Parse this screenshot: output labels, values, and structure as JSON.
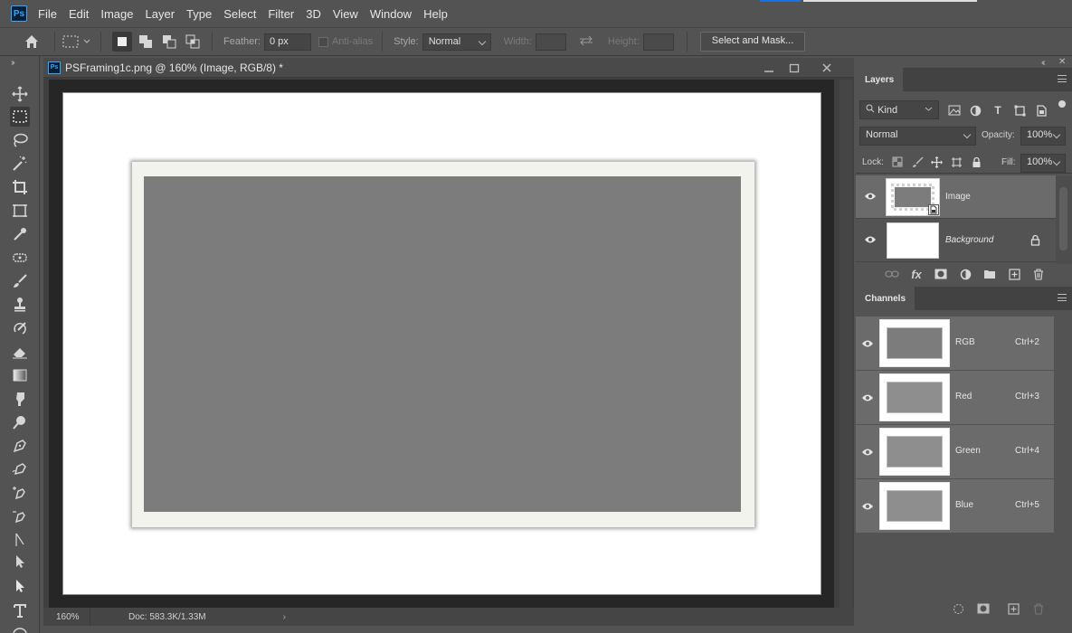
{
  "app": {
    "logo_text": "Ps",
    "menu": [
      "File",
      "Edit",
      "Image",
      "Layer",
      "Type",
      "Select",
      "Filter",
      "3D",
      "View",
      "Window",
      "Help"
    ]
  },
  "options_bar": {
    "feather_label": "Feather:",
    "feather_value": "0 px",
    "anti_alias_label": "Anti-alias",
    "style_label": "Style:",
    "style_value": "Normal",
    "width_label": "Width:",
    "height_label": "Height:",
    "select_mask_label": "Select and Mask..."
  },
  "tools": [
    "move",
    "rectangular-marquee",
    "lasso",
    "magic-wand",
    "crop",
    "frame",
    "eyedropper",
    "spot-healing",
    "brush",
    "clone-stamp",
    "history-brush",
    "eraser",
    "gradient",
    "smudge",
    "dodge",
    "pen",
    "freeform-pen",
    "add-anchor",
    "convert-point",
    "path-selection",
    "direct-selection",
    "type",
    "ellipse"
  ],
  "document": {
    "icon_text": "Ps",
    "title": "PSFraming1c.png @ 160% (Image, RGB/8) *",
    "zoom": "160%",
    "doc_size": "Doc: 583.3K/1.33M",
    "paper_color": "#ffffff",
    "frame_color": "#f3f3ed",
    "inner_color": "#7c7c7c"
  },
  "layers_panel": {
    "tab_label": "Layers",
    "filter_value": "Kind",
    "blend_mode": "Normal",
    "opacity_label": "Opacity:",
    "opacity_value": "100%",
    "lock_label": "Lock:",
    "fill_label": "Fill:",
    "fill_value": "100%",
    "layers": [
      {
        "name": "Image",
        "selected": true,
        "visible": true
      },
      {
        "name": "Background",
        "selected": false,
        "visible": true,
        "locked": true
      }
    ]
  },
  "channels_panel": {
    "tab_label": "Channels",
    "channels": [
      {
        "name": "RGB",
        "shortcut": "Ctrl+2"
      },
      {
        "name": "Red",
        "shortcut": "Ctrl+3"
      },
      {
        "name": "Green",
        "shortcut": "Ctrl+4"
      },
      {
        "name": "Blue",
        "shortcut": "Ctrl+5"
      }
    ]
  }
}
